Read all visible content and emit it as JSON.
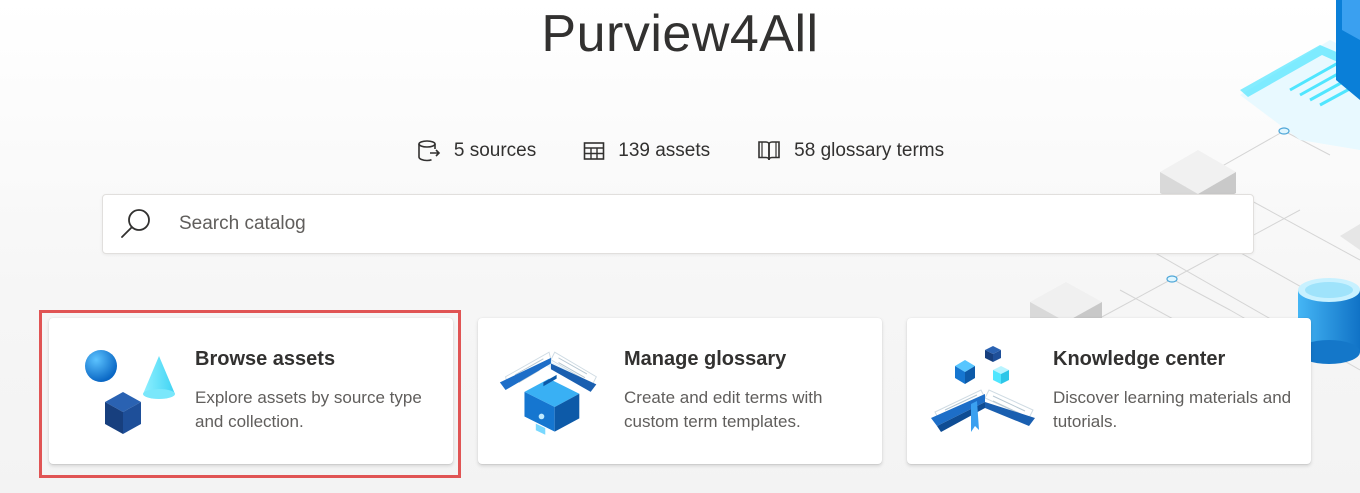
{
  "app": {
    "title": "Purview4All"
  },
  "stats": [
    {
      "label": "5 sources",
      "icon": "data-source-icon"
    },
    {
      "label": "139 assets",
      "icon": "table-icon"
    },
    {
      "label": "58 glossary terms",
      "icon": "book-icon"
    }
  ],
  "search": {
    "placeholder": "Search catalog",
    "value": ""
  },
  "cards": [
    {
      "title": "Browse assets",
      "description": "Explore assets by source type and collection.",
      "icon": "shapes-icon",
      "highlighted": true
    },
    {
      "title": "Manage glossary",
      "description": "Create and edit terms with custom term templates.",
      "icon": "book-toolbox-icon"
    },
    {
      "title": "Knowledge center",
      "description": "Discover learning materials and tutorials.",
      "icon": "book-cubes-icon"
    }
  ],
  "colors": {
    "highlight_border": "#e05454",
    "accent_blue": "#0078d4",
    "accent_cyan": "#50e6ff"
  }
}
